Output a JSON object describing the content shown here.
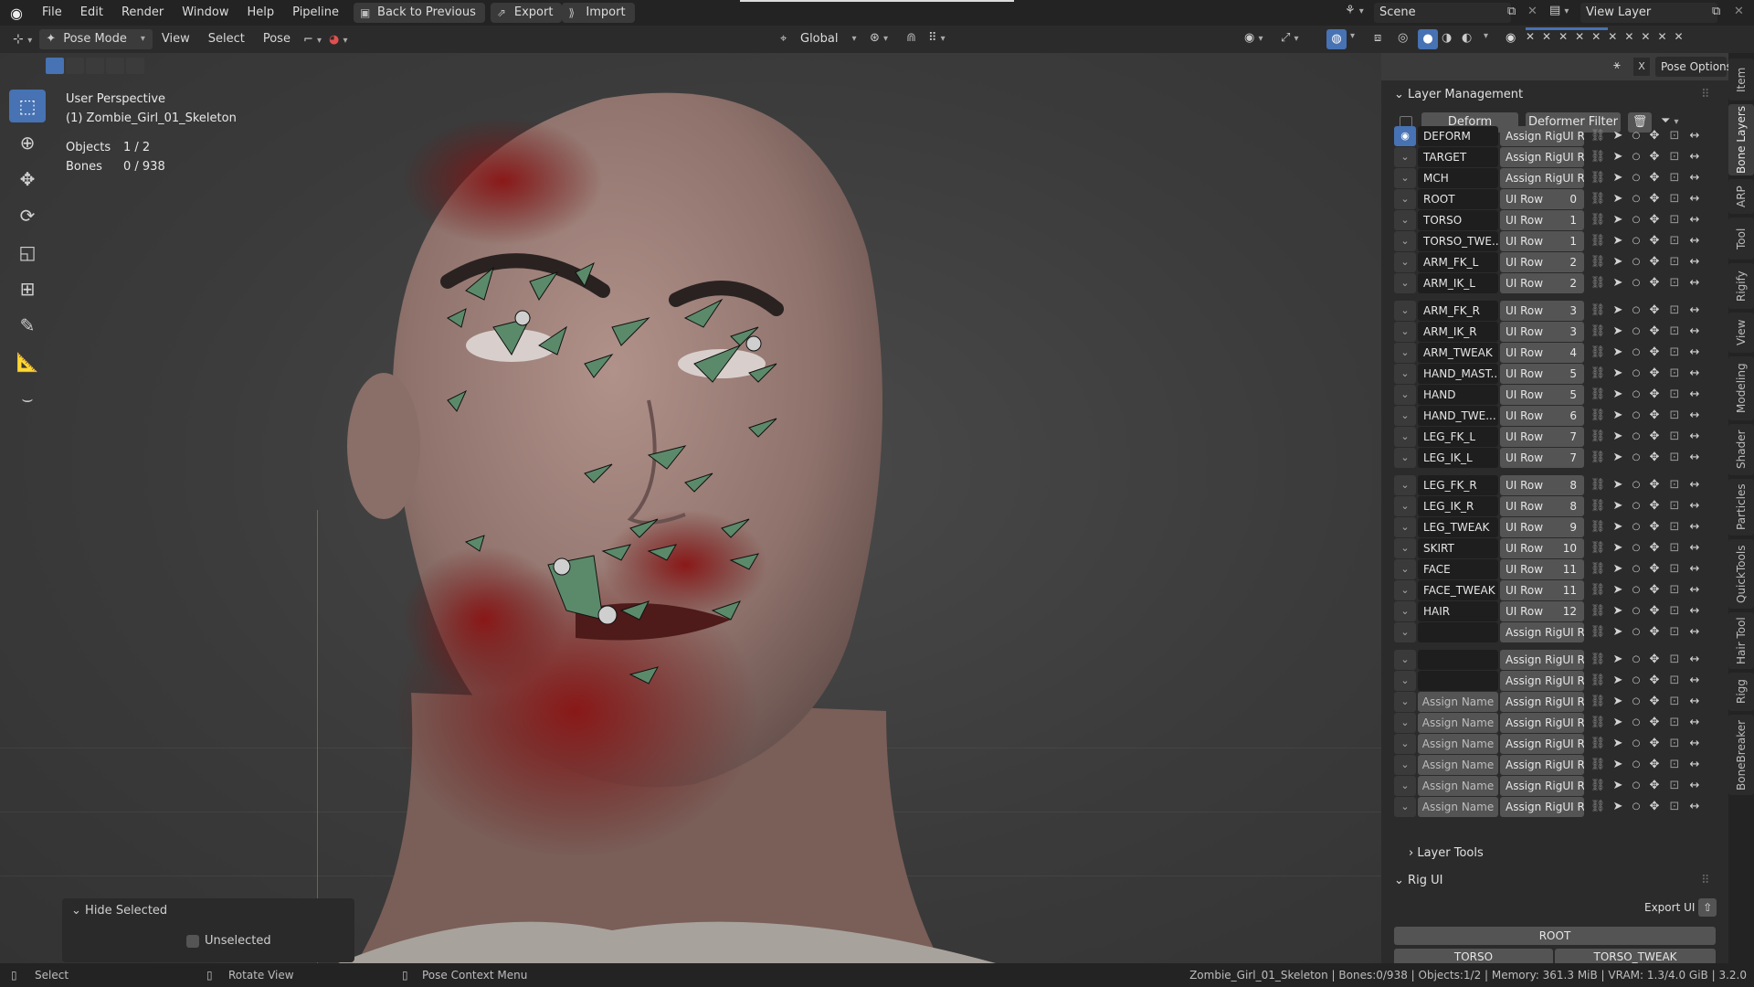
{
  "topbar": {
    "menus": [
      "File",
      "Edit",
      "Render",
      "Window",
      "Help",
      "Pipeline"
    ],
    "back_label": "Back to Previous",
    "export_label": "Export",
    "import_label": "Import",
    "scene": "Scene",
    "view_layer": "View Layer"
  },
  "header": {
    "mode": "Pose Mode",
    "menus": [
      "View",
      "Select",
      "Pose"
    ],
    "transform": "Global",
    "pose_options": "Pose Options"
  },
  "viewport": {
    "perspective": "User Perspective",
    "object": "(1) Zombie_Girl_01_Skeleton",
    "objects_label": "Objects",
    "objects_value": "1 / 2",
    "bones_label": "Bones",
    "bones_value": "0 / 938",
    "hide_panel_title": "Hide Selected",
    "unselected_label": "Unselected"
  },
  "sidebar": {
    "layer_management": "Layer Management",
    "deform_btn": "Deform",
    "deformer_filter": "Deformer Filter",
    "layers": [
      {
        "name": "DEFORM",
        "row": "Assign RigUI R...",
        "num": ""
      },
      {
        "name": "TARGET",
        "row": "Assign RigUI R...",
        "num": ""
      },
      {
        "name": "MCH",
        "row": "Assign RigUI R...",
        "num": ""
      },
      {
        "name": "ROOT",
        "row": "UI Row",
        "num": "0"
      },
      {
        "name": "TORSO",
        "row": "UI Row",
        "num": "1"
      },
      {
        "name": "TORSO_TWE...",
        "row": "UI Row",
        "num": "1"
      },
      {
        "name": "ARM_FK_L",
        "row": "UI Row",
        "num": "2"
      },
      {
        "name": "ARM_IK_L",
        "row": "UI Row",
        "num": "2"
      },
      {
        "name": "ARM_FK_R",
        "row": "UI Row",
        "num": "3"
      },
      {
        "name": "ARM_IK_R",
        "row": "UI Row",
        "num": "3"
      },
      {
        "name": "ARM_TWEAK",
        "row": "UI Row",
        "num": "4"
      },
      {
        "name": "HAND_MAST...",
        "row": "UI Row",
        "num": "5"
      },
      {
        "name": "HAND",
        "row": "UI Row",
        "num": "5"
      },
      {
        "name": "HAND_TWE...",
        "row": "UI Row",
        "num": "6"
      },
      {
        "name": "LEG_FK_L",
        "row": "UI Row",
        "num": "7"
      },
      {
        "name": "LEG_IK_L",
        "row": "UI Row",
        "num": "7"
      },
      {
        "name": "LEG_FK_R",
        "row": "UI Row",
        "num": "8"
      },
      {
        "name": "LEG_IK_R",
        "row": "UI Row",
        "num": "8"
      },
      {
        "name": "LEG_TWEAK",
        "row": "UI Row",
        "num": "9"
      },
      {
        "name": "SKIRT",
        "row": "UI Row",
        "num": "10"
      },
      {
        "name": "FACE",
        "row": "UI Row",
        "num": "11"
      },
      {
        "name": "FACE_TWEAK",
        "row": "UI Row",
        "num": "11"
      },
      {
        "name": "HAIR",
        "row": "UI Row",
        "num": "12"
      },
      {
        "name": "",
        "row": "Assign RigUI R...",
        "num": ""
      },
      {
        "name": "",
        "row": "Assign RigUI R...",
        "num": ""
      },
      {
        "name": "",
        "row": "Assign RigUI R...",
        "num": ""
      },
      {
        "name": "Assign Name",
        "row": "Assign RigUI R...",
        "num": ""
      },
      {
        "name": "Assign Name",
        "row": "Assign RigUI R...",
        "num": ""
      },
      {
        "name": "Assign Name",
        "row": "Assign RigUI R...",
        "num": ""
      },
      {
        "name": "Assign Name",
        "row": "Assign RigUI R...",
        "num": ""
      },
      {
        "name": "Assign Name",
        "row": "Assign RigUI R...",
        "num": ""
      },
      {
        "name": "Assign Name",
        "row": "Assign RigUI R...",
        "num": ""
      }
    ],
    "layer_tools": "Layer Tools",
    "rig_ui": "Rig UI",
    "export_ui": "Export UI",
    "root_btn": "ROOT",
    "torso_btn": "TORSO",
    "torso_tweak_btn": "TORSO_TWEAK"
  },
  "tabs": [
    "Item",
    "Bone Layers",
    "ARP",
    "Tool",
    "Rigify",
    "View",
    "Modeling",
    "Shader",
    "Particles",
    "QuickTools",
    "Hair Tool",
    "Rigg",
    "BoneBreaker"
  ],
  "statusbar": {
    "select": "Select",
    "rotate": "Rotate View",
    "context": "Pose Context Menu",
    "info": "Zombie_Girl_01_Skeleton | Bones:0/938 | Objects:1/2 | Memory: 361.3 MiB | VRAM: 1.3/4.0 GiB | 3.2.0"
  },
  "colors": {
    "accent": "#4772b3",
    "bone": "#5b8a6a",
    "blood": "#8a1a1a"
  }
}
